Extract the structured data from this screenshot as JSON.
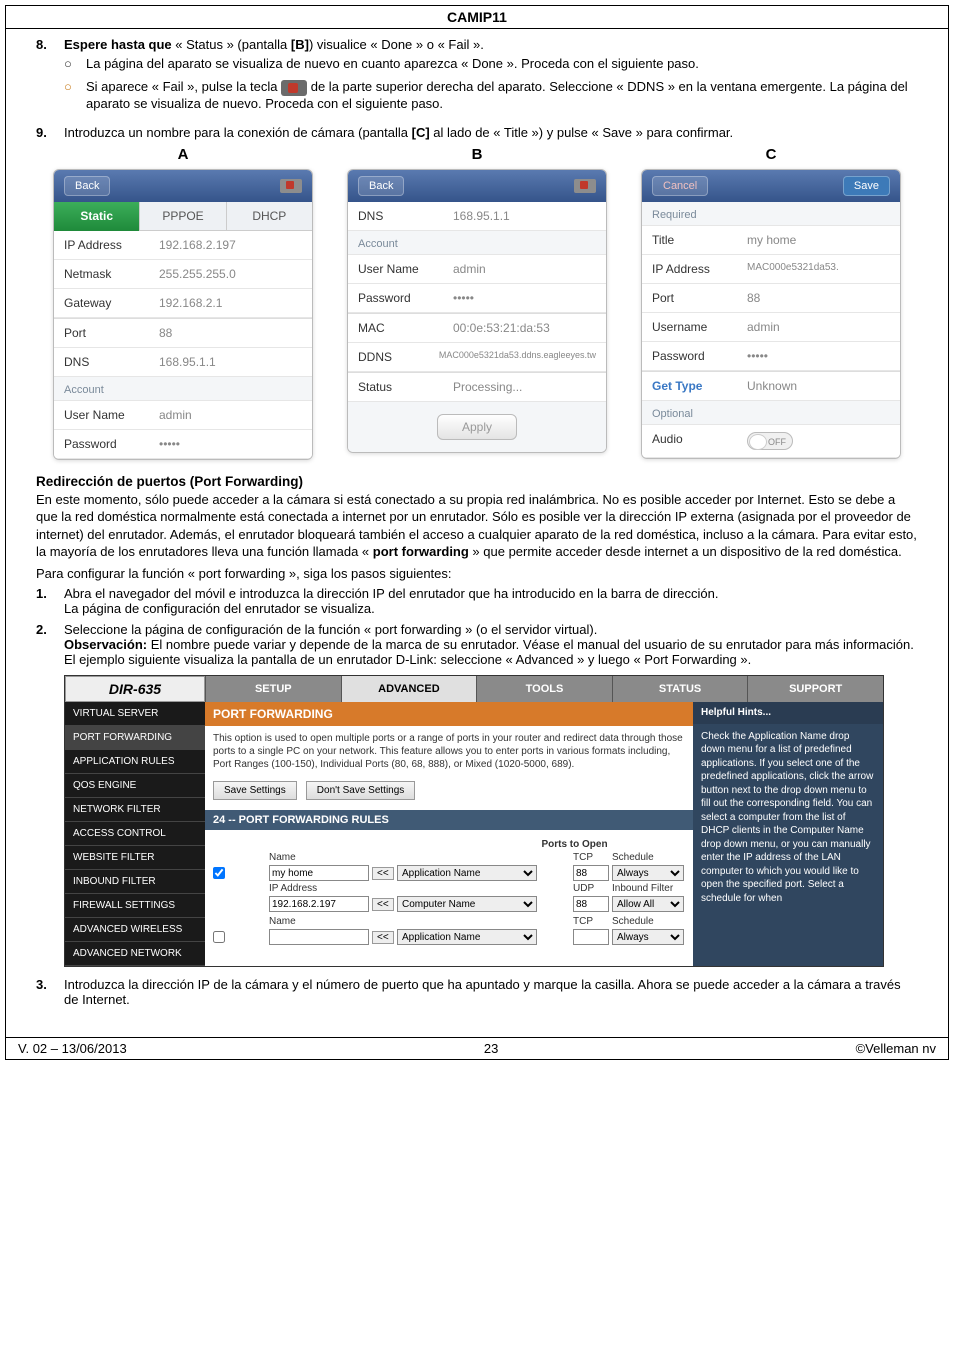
{
  "header": {
    "title": "CAMIP11"
  },
  "steps": {
    "s8_num": "8.",
    "s8_text": "Espere hasta que « Status » (pantalla [B]) visualice « Done » o « Fail ».",
    "s8_sub1": "La página del aparato se visualiza de nuevo en cuanto aparezca « Done ». Proceda con el siguiente paso.",
    "s8_sub2a": "Si aparece « Fail », pulse la tecla ",
    "s8_sub2b": " de la parte superior derecha del aparato. Seleccione « DDNS » en la ventana emergente. La página del aparato se visualiza de nuevo. Proceda con el siguiente paso.",
    "s9_num": "9.",
    "s9_text": "Introduzca un nombre para la conexión de cámara (pantalla [C] al lado de « Title ») y pulse « Save » para confirmar."
  },
  "panels": {
    "A": {
      "letter": "A",
      "back": "Back",
      "tabs": {
        "static": "Static",
        "pppoe": "PPPOE",
        "dhcp": "DHCP"
      },
      "rows": {
        "ip_l": "IP Address",
        "ip_v": "192.168.2.197",
        "nm_l": "Netmask",
        "nm_v": "255.255.255.0",
        "gw_l": "Gateway",
        "gw_v": "192.168.2.1",
        "port_l": "Port",
        "port_v": "88",
        "dns_l": "DNS",
        "dns_v": "168.95.1.1"
      },
      "account": "Account",
      "user_l": "User Name",
      "user_v": "admin",
      "pass_l": "Password",
      "pass_v": "•••••"
    },
    "B": {
      "letter": "B",
      "back": "Back",
      "rows": {
        "dns_l": "DNS",
        "dns_v": "168.95.1.1",
        "user_l": "User Name",
        "user_v": "admin",
        "pass_l": "Password",
        "pass_v": "•••••",
        "mac_l": "MAC",
        "mac_v": "00:0e:53:21:da:53",
        "ddns_l": "DDNS",
        "ddns_v": "MAC000e5321da53.ddns.eagleeyes.tw",
        "status_l": "Status",
        "status_v": "Processing..."
      },
      "account": "Account",
      "apply": "Apply"
    },
    "C": {
      "letter": "C",
      "cancel": "Cancel",
      "save": "Save",
      "required": "Required",
      "rows": {
        "title_l": "Title",
        "title_v": "my home",
        "ip_l": "IP Address",
        "ip_v": "MAC000e5321da53.",
        "port_l": "Port",
        "port_v": "88",
        "usr_l": "Username",
        "usr_v": "admin",
        "pass_l": "Password",
        "pass_v": "•••••",
        "gt_l": "Get Type",
        "gt_v": "Unknown"
      },
      "optional": "Optional",
      "audio_l": "Audio",
      "audio_v": "OFF"
    }
  },
  "portfwd": {
    "title": "Redirección de puertos (Port Forwarding)",
    "p1": "En este momento, sólo puede acceder a la cámara si está conectado a su propia red inalámbrica. No es posible acceder por Internet. Esto se debe a que la red doméstica normalmente está conectada a internet por un enrutador. Sólo es posible ver la dirección IP externa (asignada por el proveedor de internet) del enrutador. Además, el enrutador bloqueará también el acceso a cualquier aparato de la red doméstica, incluso a la cámara. Para evitar esto, la mayoría de los enrutadores lleva una función llamada « port forwarding » que permite acceder desde internet a un dispositivo de la red doméstica.",
    "p2": "Para configurar la función « port forwarding », siga los pasos siguientes:",
    "s1_num": "1.",
    "s1_a": "Abra el navegador del móvil e introduzca la dirección IP del enrutador que ha introducido en la barra de dirección.",
    "s1_b": "La página de configuración del enrutador se visualiza.",
    "s2_num": "2.",
    "s2_a": "Seleccione la página de configuración de la función « port forwarding » (o el servidor virtual).",
    "s2_b": "Observación: El nombre puede variar y depende de la marca de su enrutador. Véase el manual del usuario de su enrutador para más información.",
    "s2_c": "El ejemplo siguiente visualiza la pantalla de un enrutador D-Link: seleccione « Advanced » y luego « Port Forwarding ».",
    "s3_num": "3.",
    "s3_a": "Introduzca la dirección IP de la cámara y el número de puerto que ha apuntado y marque la casilla. Ahora se puede acceder a la cámara a través de Internet."
  },
  "router": {
    "model": "DIR-635",
    "tabs": {
      "setup": "SETUP",
      "advanced": "ADVANCED",
      "tools": "TOOLS",
      "status": "STATUS",
      "support": "SUPPORT"
    },
    "side": [
      "VIRTUAL SERVER",
      "PORT FORWARDING",
      "APPLICATION RULES",
      "QOS ENGINE",
      "NETWORK FILTER",
      "ACCESS CONTROL",
      "WEBSITE FILTER",
      "INBOUND FILTER",
      "FIREWALL SETTINGS",
      "ADVANCED WIRELESS",
      "ADVANCED NETWORK"
    ],
    "hints_title": "Helpful Hints...",
    "hints": "Check the Application Name drop down menu for a list of predefined applications. If you select one of the predefined applications, click the arrow button next to the drop down menu to fill out the corresponding field.\nYou can select a computer from the list of DHCP clients in the Computer Name drop down menu, or you can manually enter the IP address of the LAN computer to which you would like to open the specified port.\nSelect a schedule for when",
    "pfw_title": "PORT FORWARDING",
    "pfw_desc": "This option is used to open multiple ports or a range of ports in your router and redirect data through those ports to a single PC on your network. This feature allows you to enter ports in various formats including, Port Ranges (100-150), Individual Ports (80, 68, 888), or Mixed (1020-5000, 689).",
    "save_btn": "Save Settings",
    "dont_btn": "Don't Save Settings",
    "sub": "24 -- PORT FORWARDING RULES",
    "cols": {
      "pto": "Ports to Open",
      "tcp": "TCP",
      "udp": "UDP",
      "sched": "Schedule",
      "inb": "Inbound Filter"
    },
    "labels": {
      "name": "Name",
      "ip": "IP Address"
    },
    "row1": {
      "name": "my home",
      "ip": "192.168.2.197",
      "app": "Application Name",
      "comp": "Computer Name",
      "p1": "88",
      "p2": "88",
      "sched": "Always",
      "inb": "Allow All"
    },
    "row2": {
      "name": "",
      "app": "Application Name",
      "tcp": "TCP",
      "sched": "Schedule",
      "schedv": "Always"
    }
  },
  "footer": {
    "left": "V. 02 – 13/06/2013",
    "center": "23",
    "right": "©Velleman nv"
  }
}
